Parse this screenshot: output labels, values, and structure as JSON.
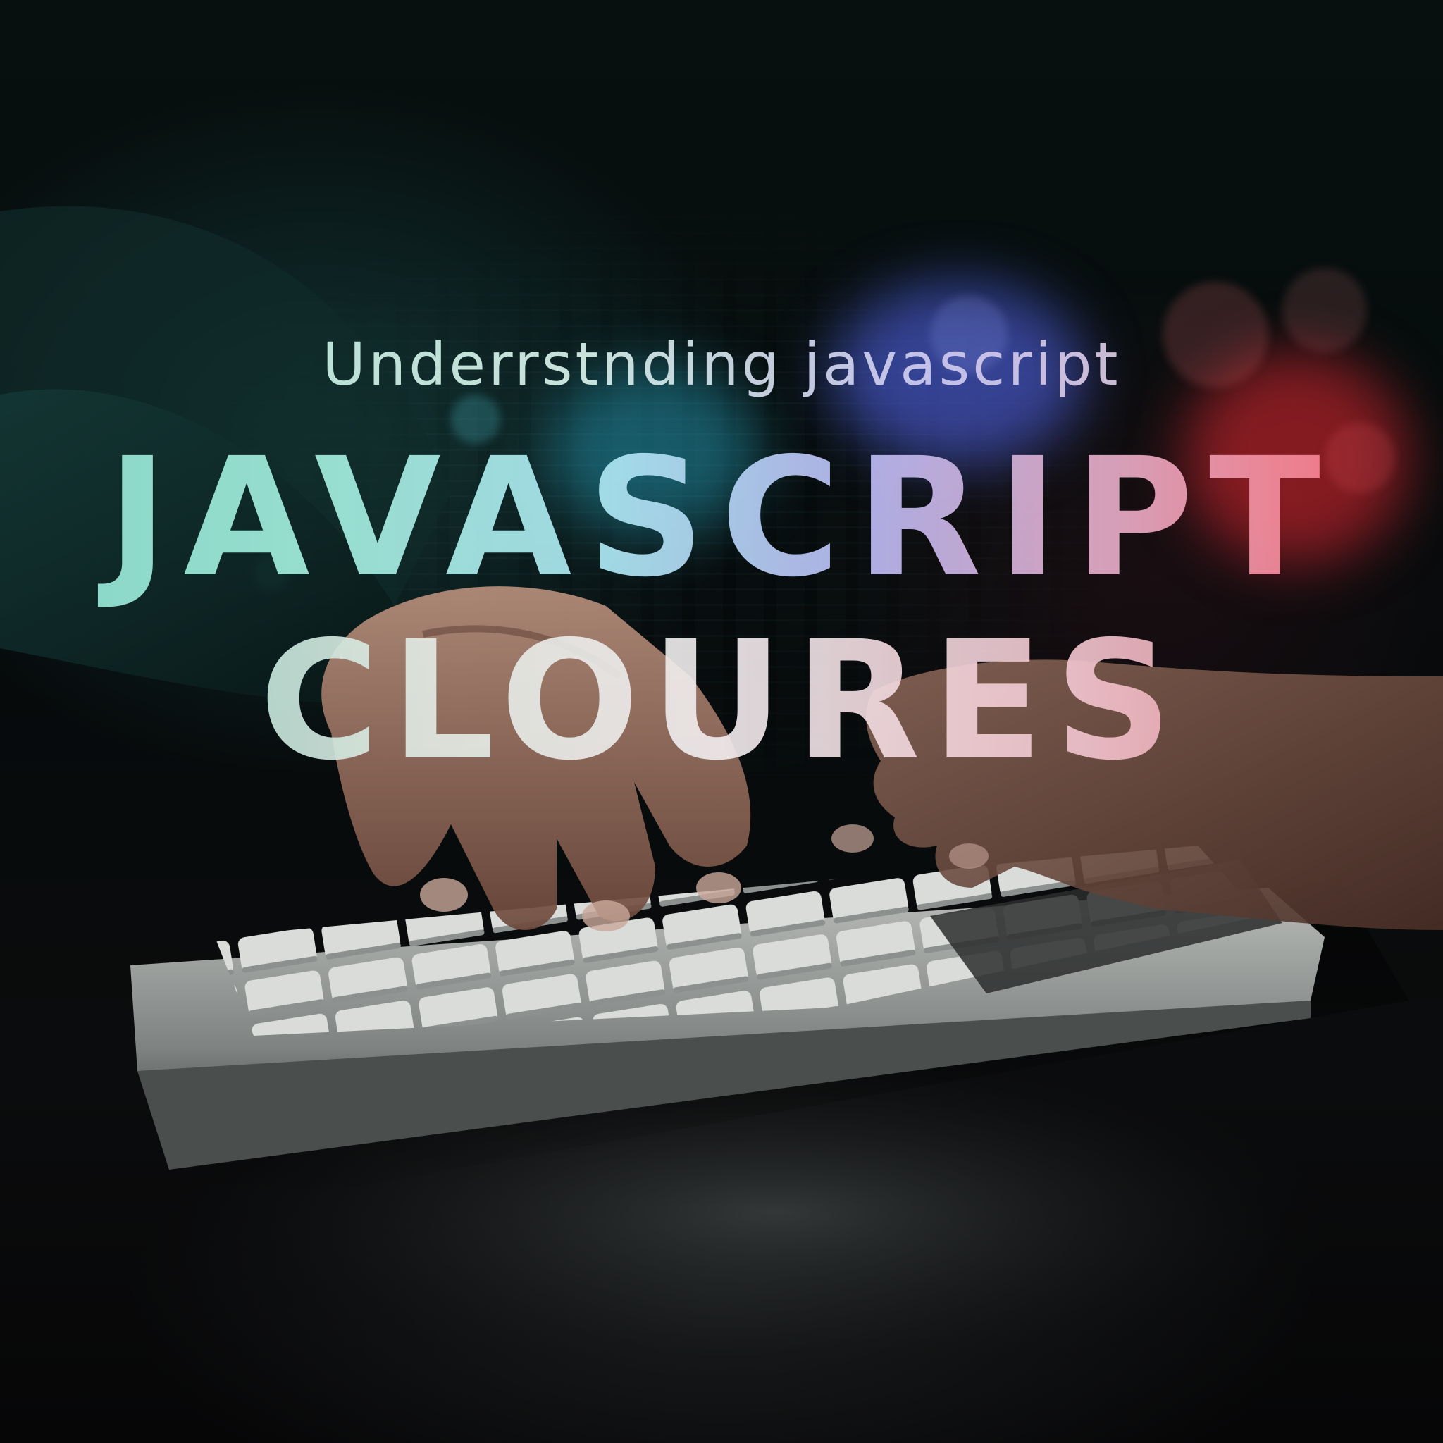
{
  "image": {
    "subtitle": "Underrstnding javascript",
    "title_line_1": "JAVASCRIPT",
    "title_line_2": "CLOURES",
    "colors": {
      "teal": "#8ee0cf",
      "lavender": "#b7b6ef",
      "red": "#ff6b74",
      "background": "#050607"
    }
  }
}
